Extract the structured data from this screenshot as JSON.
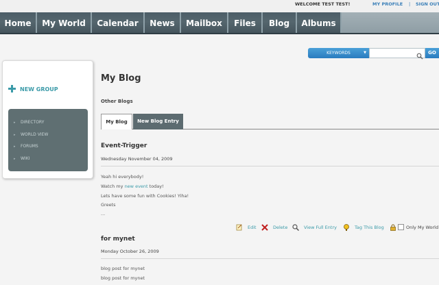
{
  "userbar": {
    "welcome": "WELCOME TEST TEST!",
    "profile": "MY PROFILE",
    "separator": "|",
    "signout": "SIGN OUT"
  },
  "nav": {
    "items": [
      {
        "label": "Home"
      },
      {
        "label": "My World"
      },
      {
        "label": "Calendar"
      },
      {
        "label": "News"
      },
      {
        "label": "Mailbox"
      },
      {
        "label": "Files"
      },
      {
        "label": "Blog"
      },
      {
        "label": "Albums"
      }
    ]
  },
  "search": {
    "dropdown_label": "KEYWORDS",
    "input_value": "",
    "go_label": "GO"
  },
  "sidebar": {
    "new_group": "NEW GROUP",
    "links": [
      {
        "label": "DIRECTORY"
      },
      {
        "label": "WORLD VIEW"
      },
      {
        "label": "FORUMS"
      },
      {
        "label": "WIKI"
      }
    ]
  },
  "main": {
    "title": "My Blog",
    "other_blogs": "Other Blogs",
    "tabs": [
      {
        "label": "My Blog",
        "active": true
      },
      {
        "label": "New Blog Entry",
        "active": false
      }
    ],
    "entries": [
      {
        "title": "Event-Trigger",
        "date": "Wednesday November 04, 2009",
        "lines": [
          {
            "text": "Yeah hi everybody!"
          },
          {
            "before": "Watch my ",
            "link": "new event",
            "after": " today!"
          },
          {
            "text": "Lets have some fun with Cookies! Yiha!"
          },
          {
            "text": "Greets"
          },
          {
            "text": "..."
          }
        ],
        "actions": {
          "edit": "Edit",
          "delete": "Delete",
          "view_full": "View Full Entry",
          "tag": "Tag This Blog",
          "only_my_world": "Only My World"
        }
      },
      {
        "title": "for mynet",
        "date": "Monday October 26, 2009",
        "lines": [
          {
            "text": "blog post for mynet"
          },
          {
            "text": "blog post for mynet"
          }
        ]
      }
    ]
  },
  "colors": {
    "nav_bg": "#4c5d67",
    "accent_blue": "#2a7cbf",
    "link_teal": "#3a9aa8",
    "tab_dark": "#5c6b70"
  }
}
